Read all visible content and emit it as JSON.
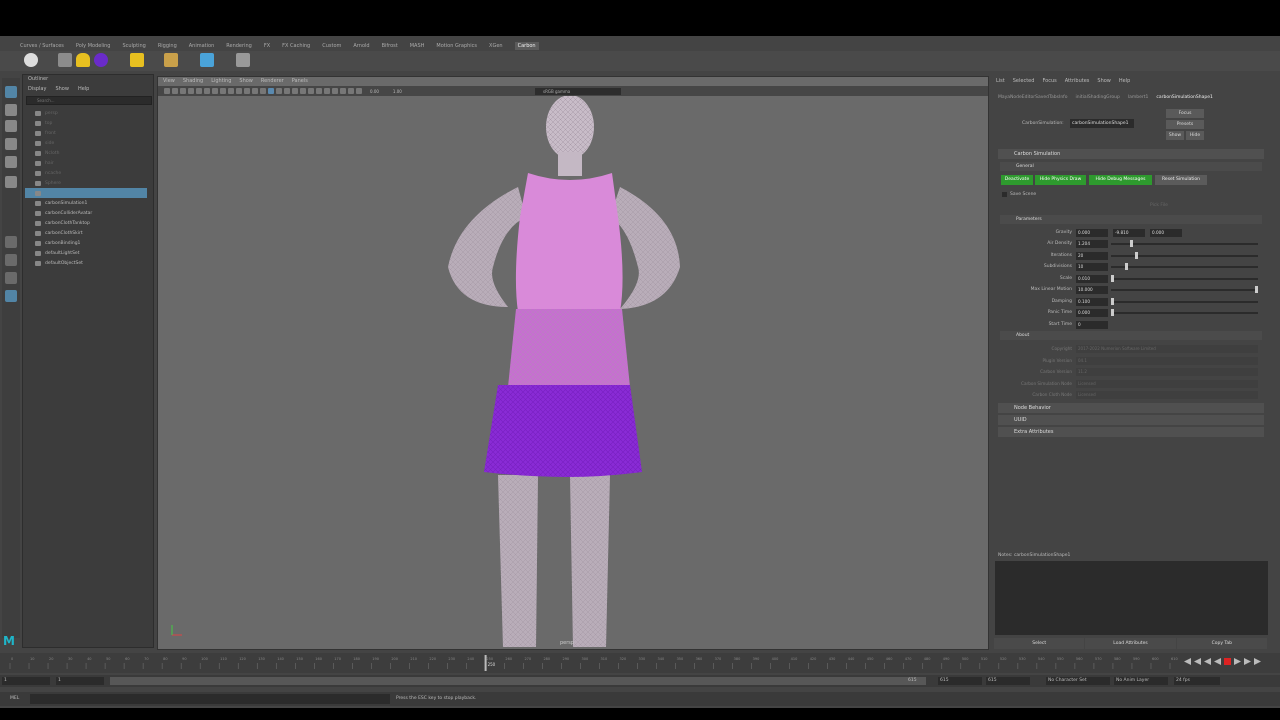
{
  "shelf": {
    "tabs": [
      "Curves / Surfaces",
      "Poly Modeling",
      "Sculpting",
      "Rigging",
      "Animation",
      "Rendering",
      "FX",
      "FX Caching",
      "Custom",
      "Arnold",
      "Bifrost",
      "MASH",
      "Motion Graphics",
      "XGen",
      "Carbon"
    ],
    "active_tab": "Carbon"
  },
  "outliner": {
    "title": "Outliner",
    "menu": [
      "Display",
      "Show",
      "Help"
    ],
    "search_placeholder": "Search...",
    "items": [
      {
        "label": "persp",
        "dim": true
      },
      {
        "label": "top",
        "dim": true
      },
      {
        "label": "front",
        "dim": true
      },
      {
        "label": "side",
        "dim": true
      },
      {
        "label": "Ncloth",
        "dim": true
      },
      {
        "label": "hair",
        "dim": true
      },
      {
        "label": "ncache",
        "dim": true
      },
      {
        "label": "Sphere",
        "dim": true
      },
      {
        "label": "",
        "selected": true
      },
      {
        "label": "carbonSimulation1"
      },
      {
        "label": "carbonColliderAvatar"
      },
      {
        "label": "carbonClothTanktop"
      },
      {
        "label": "carbonClothSkirt"
      },
      {
        "label": "carbonBinding1"
      },
      {
        "label": "defaultLightSet"
      },
      {
        "label": "defaultObjectSet"
      }
    ]
  },
  "viewport": {
    "menu": [
      "View",
      "Shading",
      "Lighting",
      "Show",
      "Renderer",
      "Panels"
    ],
    "field_a": "0.00",
    "field_b": "1.00",
    "colorspace": "sRGB gamma",
    "camera_label": "persp"
  },
  "attribute_editor": {
    "menu": [
      "List",
      "Selected",
      "Focus",
      "Attributes",
      "Show",
      "Help"
    ],
    "tabs": [
      "MayaNodeEditorSavedTabsInfo",
      "initialShadingGroup",
      "lambert1",
      "carbonSimulationShape1"
    ],
    "active_tab": "carbonSimulationShape1",
    "node_label": "CarbonSimulation:",
    "node_value": "carbonSimulationShape1",
    "side_buttons": [
      "Focus",
      "Presets",
      "Show",
      "Hide"
    ],
    "section_title": "Carbon Simulation",
    "general_title": "General",
    "buttons": {
      "deactivate": "Deactivate",
      "hide_physics_draw": "Hide Physics Draw",
      "hide_debug_messages": "Hide Debug Messages",
      "reset_simulation": "Reset Simulation"
    },
    "save_scene": "Save Scene",
    "pick_file": "Pick File",
    "parameters_title": "Parameters",
    "parameters": [
      {
        "label": "Gravity",
        "values": [
          "0.000",
          "-9.810",
          "0.000"
        ]
      },
      {
        "label": "Air Density",
        "value": "1.204",
        "slider": 0.13
      },
      {
        "label": "Iterations",
        "value": "20",
        "slider": 0.17
      },
      {
        "label": "Subdivisions",
        "value": "10",
        "slider": 0.1
      },
      {
        "label": "Scale",
        "value": "0.010",
        "slider": 0.0
      },
      {
        "label": "Max Linear Motion",
        "value": "10.000",
        "slider": 1.0
      },
      {
        "label": "Damping",
        "value": "0.100",
        "slider": 0.0
      },
      {
        "label": "Panic Time",
        "value": "0.000",
        "slider": 0.0
      },
      {
        "label": "Start Time",
        "value": "0"
      }
    ],
    "about_title": "About",
    "about": [
      {
        "label": "Copyright",
        "value": "2017-2022 Numerion Software Limited"
      },
      {
        "label": "Plugin Version",
        "value": "04.1"
      },
      {
        "label": "Carbon Version",
        "value": "11.2"
      },
      {
        "label": "Carbon Simulation Node",
        "value": "Licensed"
      },
      {
        "label": "Carbon Cloth Node",
        "value": "Licensed"
      }
    ],
    "collapsed_sections": [
      "Node Behavior",
      "UUID",
      "Extra Attributes"
    ],
    "notes_label": "Notes: carbonSimulationShape1",
    "bottom_buttons": [
      "Select",
      "Load Attributes",
      "Copy Tab"
    ]
  },
  "timeline": {
    "ticks": [
      "0",
      "10",
      "20",
      "30",
      "40",
      "50",
      "60",
      "70",
      "80",
      "90",
      "100",
      "110",
      "120",
      "130",
      "140",
      "150",
      "160",
      "170",
      "180",
      "190",
      "200",
      "210",
      "220",
      "230",
      "240",
      "250",
      "260",
      "270",
      "280",
      "290",
      "300",
      "310",
      "320",
      "330",
      "340",
      "350",
      "360",
      "370",
      "380",
      "390",
      "400",
      "410",
      "420",
      "430",
      "440",
      "450",
      "460",
      "470",
      "480",
      "490",
      "500",
      "510",
      "520",
      "530",
      "540",
      "550",
      "560",
      "570",
      "580",
      "590",
      "600",
      "610"
    ],
    "current_frame": "250",
    "current_fraction": 0.41,
    "range_start": "1",
    "range_start_inner": "1",
    "range_end_inner": "615",
    "range_end_a": "615",
    "range_end_b": "615",
    "character_set": "No Character Set",
    "anim_layer": "No Anim Layer",
    "fps": "24 fps"
  },
  "status": {
    "mel_label": "MEL",
    "help_line": "Press the ESC key to stop playback."
  },
  "colors": {
    "accent_green": "#2e9a2e",
    "selection_blue": "#5285a6",
    "dress_purple": "#8a2bd6",
    "top_pink": "#d98ad9"
  }
}
